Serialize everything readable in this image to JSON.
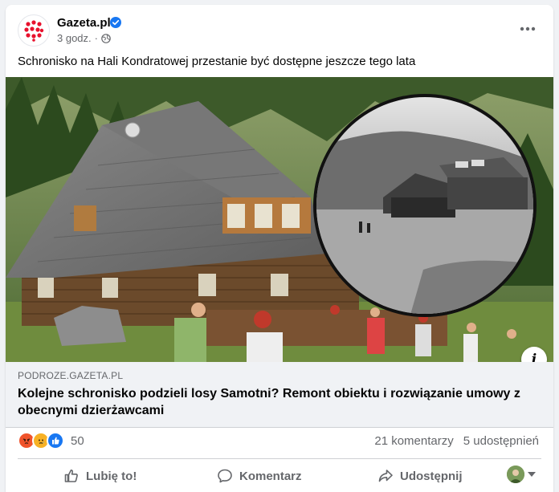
{
  "post": {
    "page_name": "Gazeta.pl",
    "time": "3 godz.",
    "separator": "·",
    "text": "Schronisko na Hali Kondratowej przestanie być dostępne jeszcze tego lata"
  },
  "link": {
    "domain": "PODROZE.GAZETA.PL",
    "title": "Kolejne schronisko podzieli losy Samotni? Remont obiektu i rozwiązanie umowy z obecnymi dzierżawcami"
  },
  "stats": {
    "reaction_count": "50",
    "comments": "21 komentarzy",
    "shares": "5 udostępnień"
  },
  "actions": {
    "like": "Lubię to!",
    "comment": "Komentarz",
    "share": "Udostępnij"
  },
  "icons": {
    "verified": "verified-badge-icon",
    "globe": "globe-icon",
    "more": "more-options-icon",
    "info": "info-icon",
    "info_glyph": "i",
    "reactions": [
      "angry-reaction-icon",
      "sad-reaction-icon",
      "like-reaction-icon"
    ]
  },
  "colors": {
    "brand_red": "#e8112d",
    "facebook_blue": "#1877f2",
    "angry": "#f0532b",
    "sad": "#f7b125"
  }
}
